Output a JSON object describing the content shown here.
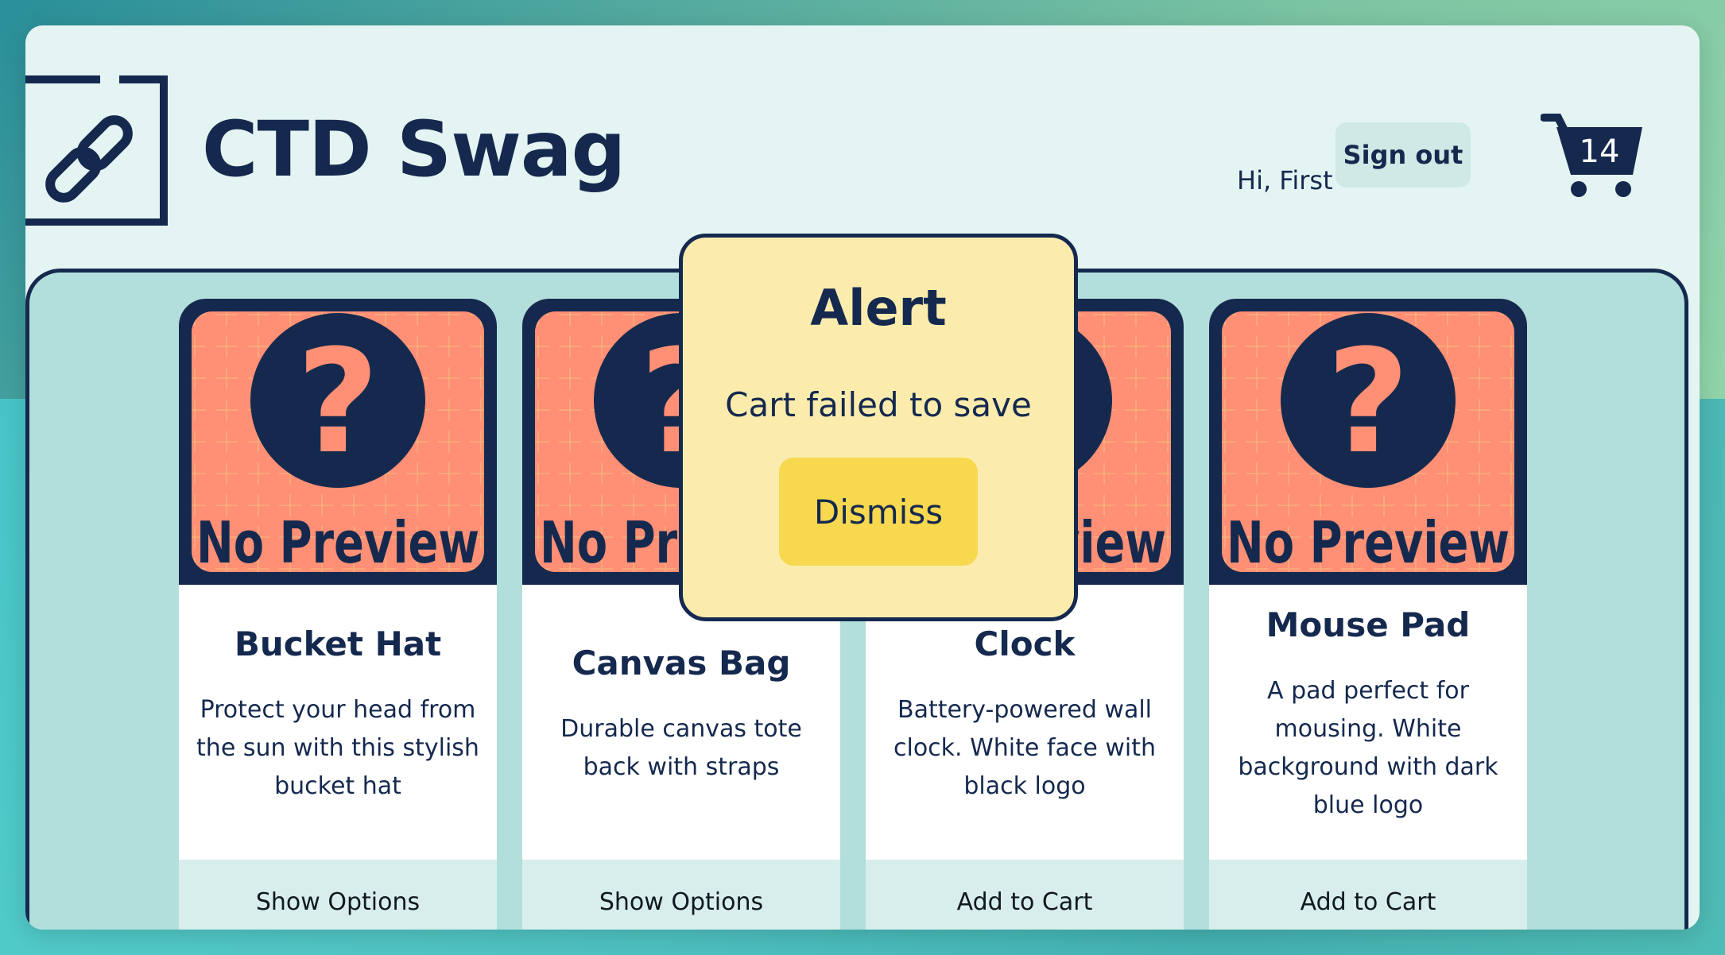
{
  "header": {
    "site_title": "CTD Swag",
    "greeting": "Hi, First",
    "signout_label": "Sign out",
    "cart_count": "14"
  },
  "placeholder_image_text": "No Preview",
  "products": [
    {
      "title": "Bucket Hat",
      "description": "Protect your head from the sun with this stylish bucket hat",
      "button_label": "Show Options"
    },
    {
      "title": "Canvas Bag",
      "description": "Durable canvas tote back with straps",
      "button_label": "Show Options"
    },
    {
      "title": "Clock",
      "description": "Battery-powered wall clock. White face with black logo",
      "button_label": "Add to Cart"
    },
    {
      "title": "Mouse Pad",
      "description": "A pad perfect for mousing. White background with dark blue logo",
      "button_label": "Add to Cart"
    }
  ],
  "alert": {
    "title": "Alert",
    "message": "Cart failed to save",
    "dismiss_label": "Dismiss"
  },
  "colors": {
    "navy": "#15294e",
    "panel": "#b2dfdc",
    "page": "#e4f4f3",
    "placeholder_bg": "#ff8f75",
    "alert_bg": "#fbecae",
    "dismiss_bg": "#f7d84f"
  }
}
